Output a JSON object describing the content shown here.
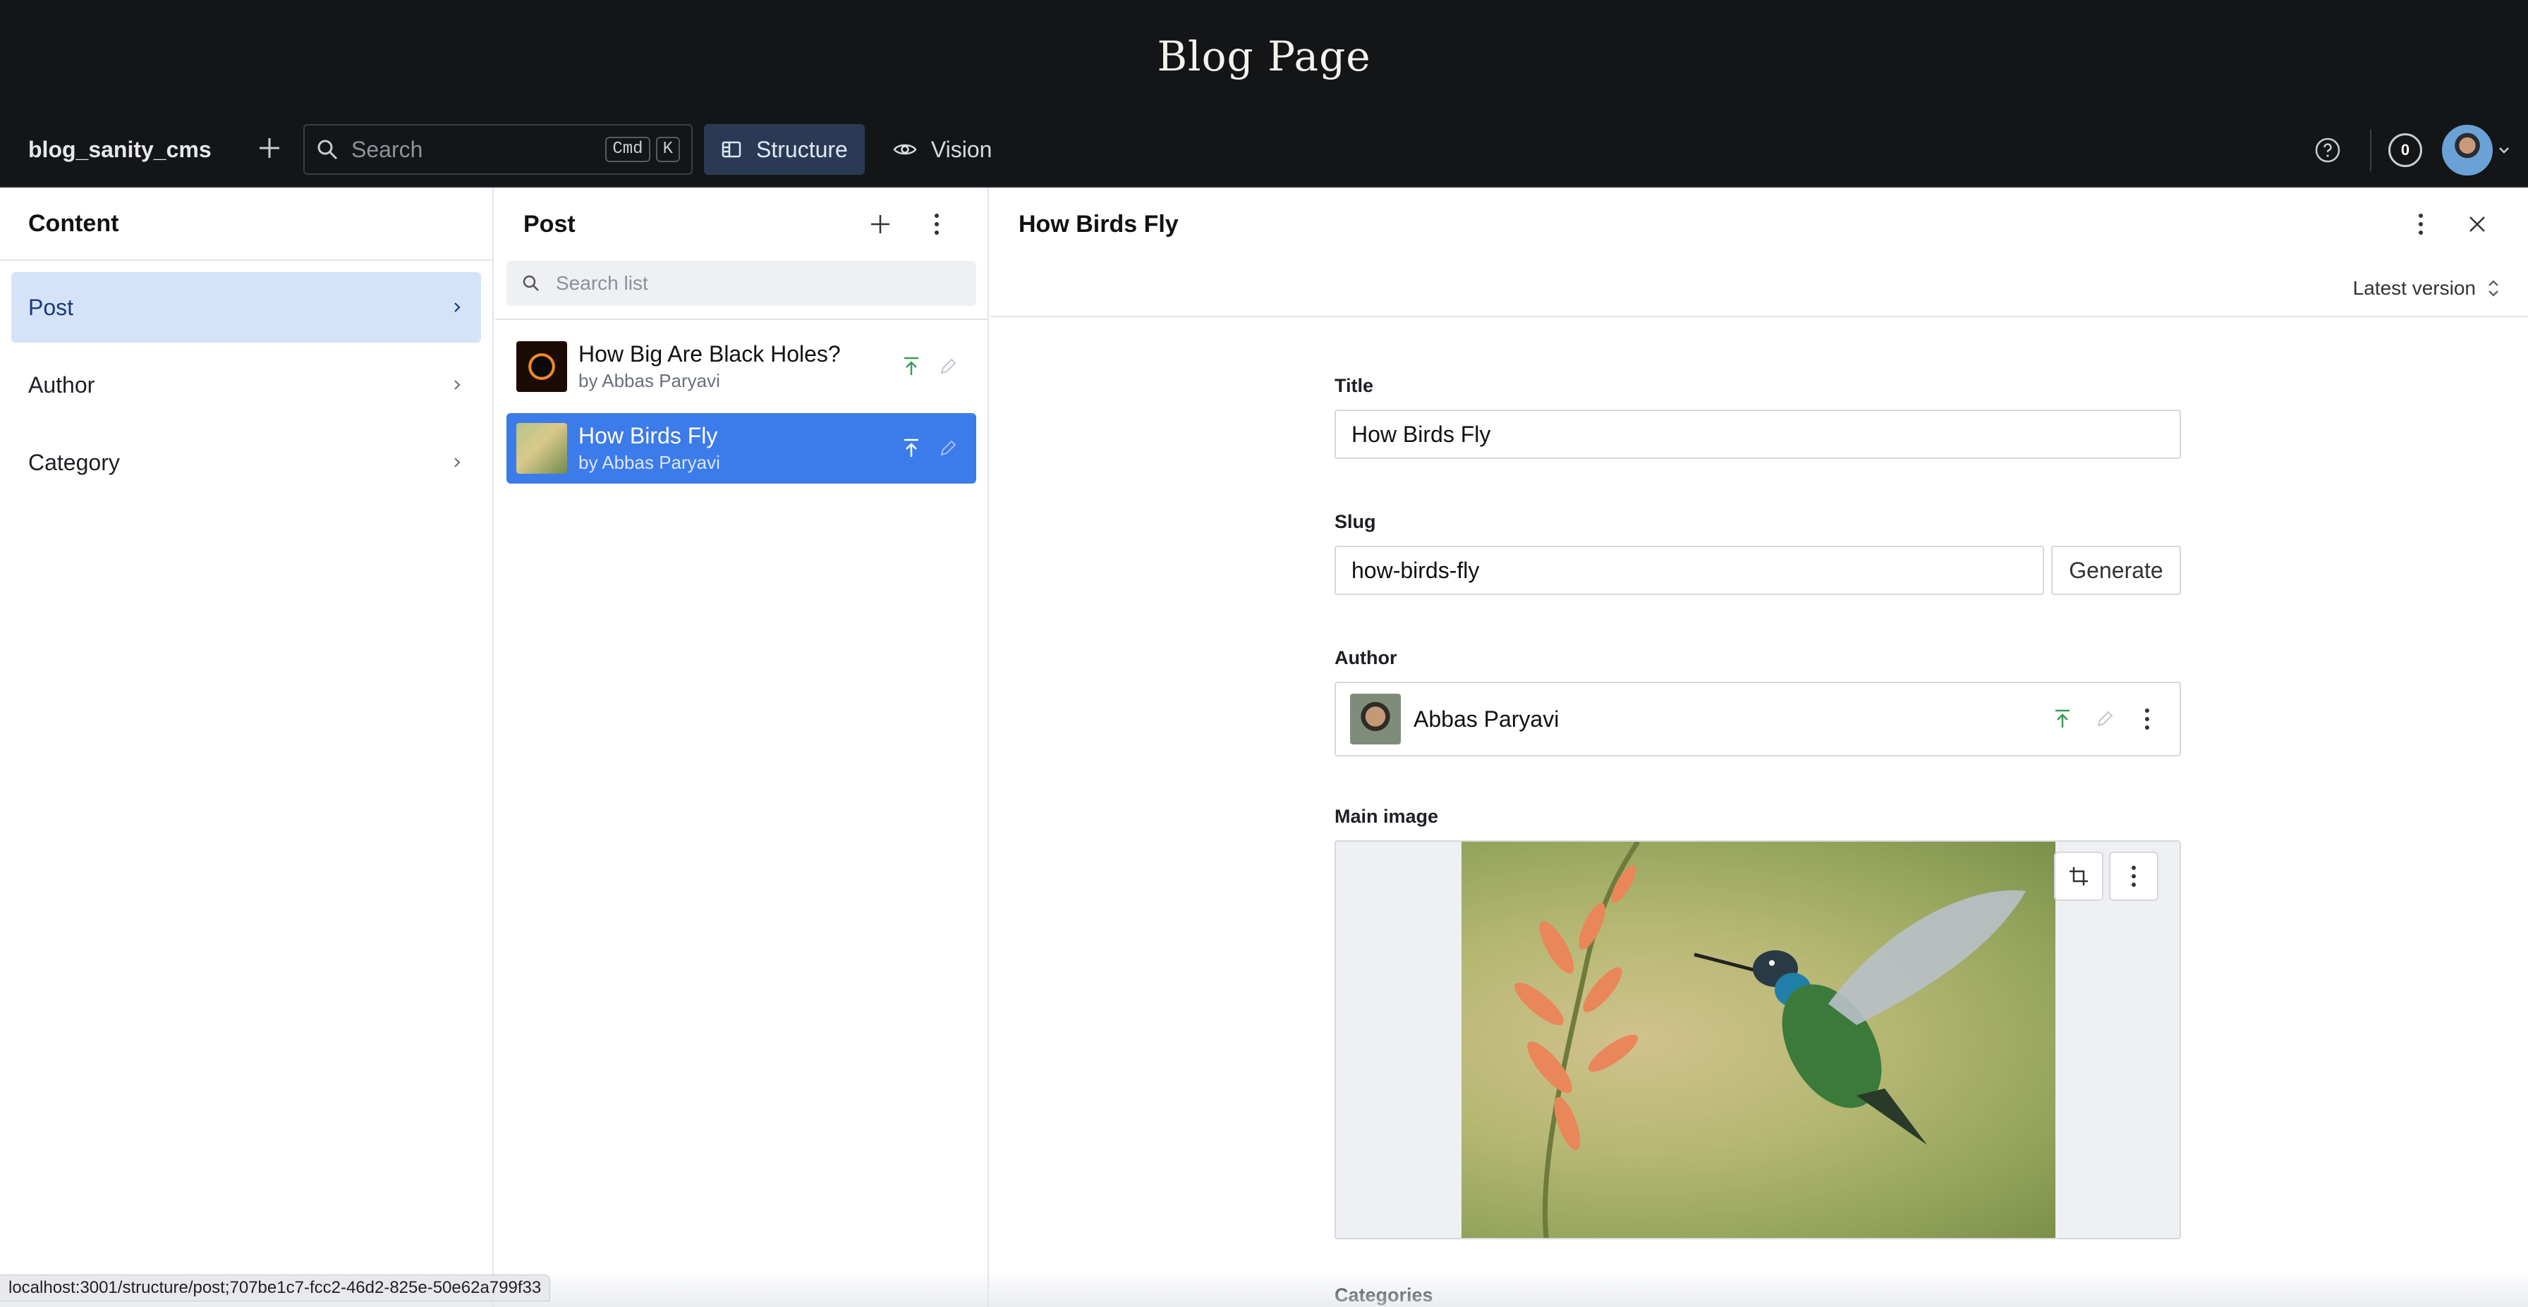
{
  "banner": {
    "title": "Blog Page"
  },
  "navbar": {
    "project": "blog_sanity_cms",
    "search": {
      "placeholder": "Search",
      "shortcut_mod": "Cmd",
      "shortcut_key": "K"
    },
    "tools": [
      {
        "label": "Structure",
        "active": true
      },
      {
        "label": "Vision",
        "active": false
      }
    ],
    "notifications_count": "0"
  },
  "content_pane": {
    "title": "Content",
    "items": [
      {
        "label": "Post",
        "selected": true
      },
      {
        "label": "Author"
      },
      {
        "label": "Category"
      }
    ]
  },
  "post_pane": {
    "title": "Post",
    "search_placeholder": "Search list",
    "documents": [
      {
        "title": "How Big Are Black Holes?",
        "subtitle": "by Abbas Paryavi",
        "selected": false
      },
      {
        "title": "How Birds Fly",
        "subtitle": "by Abbas Paryavi",
        "selected": true
      }
    ]
  },
  "document": {
    "title": "How Birds Fly",
    "version_label": "Latest version",
    "fields": {
      "title": {
        "label": "Title",
        "value": "How Birds Fly"
      },
      "slug": {
        "label": "Slug",
        "value": "how-birds-fly",
        "button": "Generate"
      },
      "author": {
        "label": "Author",
        "value": "Abbas Paryavi"
      },
      "main_image": {
        "label": "Main image"
      },
      "categories": {
        "label": "Categories"
      }
    }
  },
  "status_bar": {
    "url": "localhost:3001/structure/post;707be1c7-fcc2-46d2-825e-50e62a799f33"
  },
  "colors": {
    "accent": "#3c7bea",
    "selected_item_bg": "#d5e3f8",
    "navbar_bg": "#141517",
    "publish_green": "#3a9a5b"
  }
}
